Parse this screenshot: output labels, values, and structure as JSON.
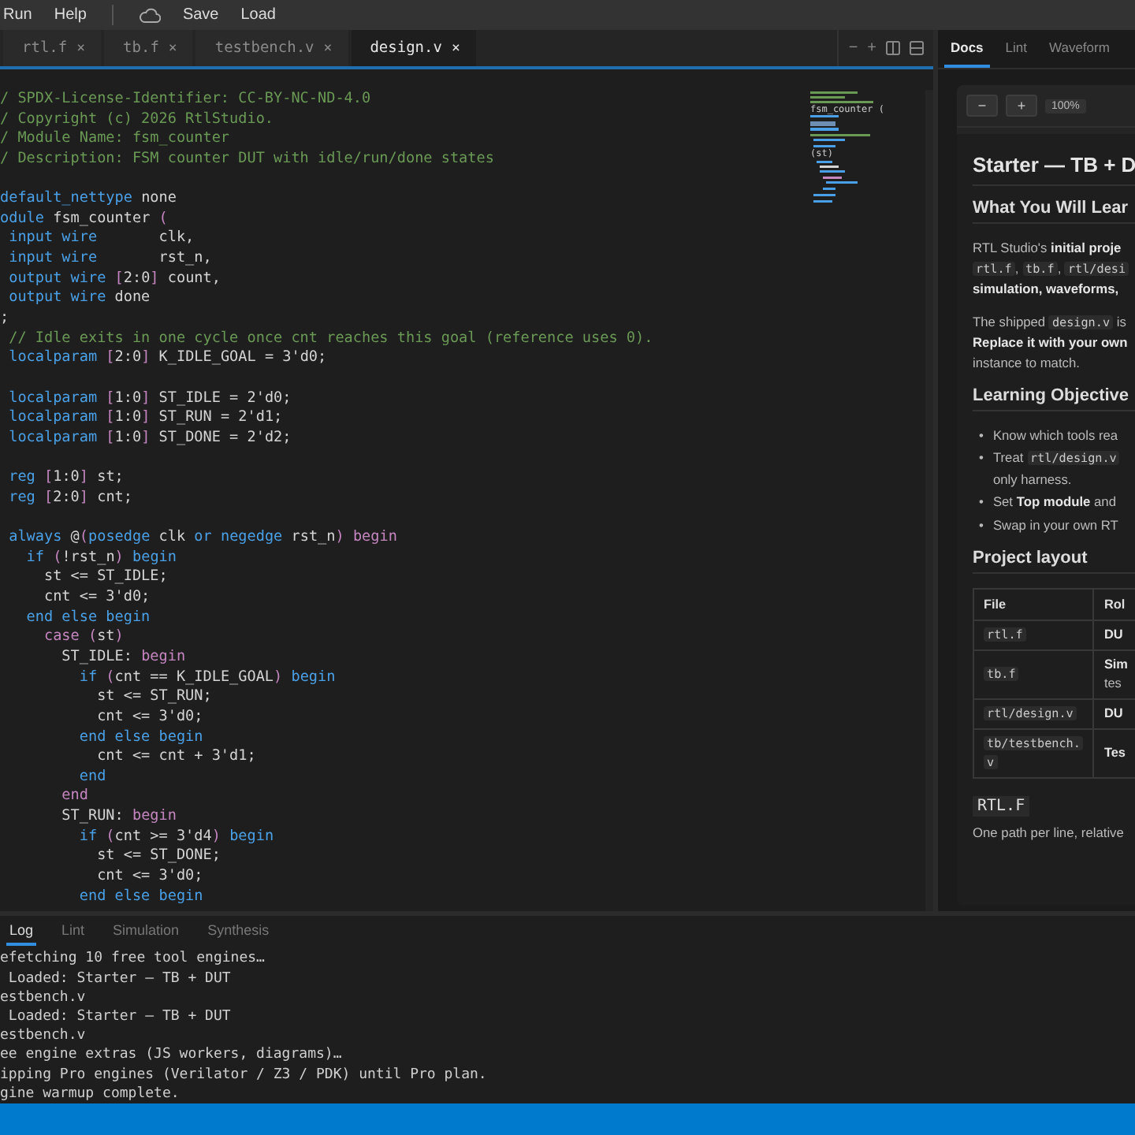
{
  "menu": {
    "items": [
      "Run",
      "Help"
    ],
    "actions": [
      "Save",
      "Load"
    ]
  },
  "editor_tabs": [
    {
      "label": "rtl.f",
      "close": "×",
      "selected": false
    },
    {
      "label": "tb.f",
      "close": "×",
      "selected": false
    },
    {
      "label": "testbench.v",
      "close": "×",
      "selected": false
    },
    {
      "label": "design.v",
      "close": "×",
      "selected": true
    }
  ],
  "editor_actions": [
    "−",
    "+"
  ],
  "code_lines": [
    {
      "kind": "code",
      "segs": [
        {
          "kind": "cm",
          "text": "/ SPDX-License-Identifier: CC-BY-NC-ND-4.0"
        }
      ]
    },
    {
      "kind": "code",
      "segs": [
        {
          "kind": "cm",
          "text": "/ Copyright (c) 2026 RtlStudio."
        }
      ]
    },
    {
      "kind": "code",
      "segs": [
        {
          "kind": "cm",
          "text": "/ Module Name: fsm_counter"
        }
      ]
    },
    {
      "kind": "code",
      "segs": [
        {
          "kind": "cm",
          "text": "/ Description: FSM counter DUT with idle/run/done states"
        }
      ]
    },
    {
      "kind": "blank"
    },
    {
      "kind": "code",
      "segs": [
        {
          "kind": "kw",
          "text": "default_nettype"
        },
        {
          "kind": "id",
          "text": " none"
        }
      ]
    },
    {
      "kind": "code",
      "segs": [
        {
          "kind": "kw",
          "text": "odule"
        },
        {
          "kind": "id",
          "text": " fsm_counter"
        },
        {
          "kind": "br",
          "text": " ("
        }
      ]
    },
    {
      "kind": "code",
      "segs": [
        {
          "kind": "kw",
          "text": " input wire"
        },
        {
          "kind": "id",
          "text": "       clk,"
        }
      ]
    },
    {
      "kind": "code",
      "segs": [
        {
          "kind": "kw",
          "text": " input wire"
        },
        {
          "kind": "id",
          "text": "       rst_n,"
        }
      ]
    },
    {
      "kind": "code",
      "segs": [
        {
          "kind": "kw",
          "text": " output wire"
        },
        {
          "kind": "br",
          "text": " ["
        },
        {
          "kind": "id",
          "text": "2:0"
        },
        {
          "kind": "br",
          "text": "]"
        },
        {
          "kind": "id",
          "text": " count,"
        }
      ]
    },
    {
      "kind": "code",
      "segs": [
        {
          "kind": "kw",
          "text": " output wire"
        },
        {
          "kind": "id",
          "text": " done"
        }
      ]
    },
    {
      "kind": "code",
      "segs": [
        {
          "kind": "id",
          "text": ";"
        }
      ]
    },
    {
      "kind": "code",
      "segs": [
        {
          "kind": "cm",
          "text": " // Idle exits in one cycle once cnt reaches this goal (reference uses 0)."
        }
      ]
    },
    {
      "kind": "code",
      "segs": [
        {
          "kind": "kw",
          "text": " localparam"
        },
        {
          "kind": "br",
          "text": " ["
        },
        {
          "kind": "id",
          "text": "2:0"
        },
        {
          "kind": "br",
          "text": "]"
        },
        {
          "kind": "id",
          "text": " K_IDLE_GOAL = 3'd0;"
        }
      ]
    },
    {
      "kind": "blank"
    },
    {
      "kind": "code",
      "segs": [
        {
          "kind": "kw",
          "text": " localparam"
        },
        {
          "kind": "br",
          "text": " ["
        },
        {
          "kind": "id",
          "text": "1:0"
        },
        {
          "kind": "br",
          "text": "]"
        },
        {
          "kind": "id",
          "text": " ST_IDLE = 2'd0;"
        }
      ]
    },
    {
      "kind": "code",
      "segs": [
        {
          "kind": "kw",
          "text": " localparam"
        },
        {
          "kind": "br",
          "text": " ["
        },
        {
          "kind": "id",
          "text": "1:0"
        },
        {
          "kind": "br",
          "text": "]"
        },
        {
          "kind": "id",
          "text": " ST_RUN = 2'd1;"
        }
      ]
    },
    {
      "kind": "code",
      "segs": [
        {
          "kind": "kw",
          "text": " localparam"
        },
        {
          "kind": "br",
          "text": " ["
        },
        {
          "kind": "id",
          "text": "1:0"
        },
        {
          "kind": "br",
          "text": "]"
        },
        {
          "kind": "id",
          "text": " ST_DONE = 2'd2;"
        }
      ]
    },
    {
      "kind": "blank"
    },
    {
      "kind": "code",
      "segs": [
        {
          "kind": "kw",
          "text": " reg"
        },
        {
          "kind": "br",
          "text": " ["
        },
        {
          "kind": "id",
          "text": "1:0"
        },
        {
          "kind": "br",
          "text": "]"
        },
        {
          "kind": "id",
          "text": " st;"
        }
      ]
    },
    {
      "kind": "code",
      "segs": [
        {
          "kind": "kw",
          "text": " reg"
        },
        {
          "kind": "br",
          "text": " ["
        },
        {
          "kind": "id",
          "text": "2:0"
        },
        {
          "kind": "br",
          "text": "]"
        },
        {
          "kind": "id",
          "text": " cnt;"
        }
      ]
    },
    {
      "kind": "blank"
    },
    {
      "kind": "code",
      "segs": [
        {
          "kind": "kw",
          "text": " always"
        },
        {
          "kind": "id",
          "text": " @"
        },
        {
          "kind": "br",
          "text": "("
        },
        {
          "kind": "kw",
          "text": "posedge"
        },
        {
          "kind": "id",
          "text": " clk"
        },
        {
          "kind": "kw",
          "text": " or negedge"
        },
        {
          "kind": "id",
          "text": " rst_n"
        },
        {
          "kind": "br",
          "text": ") begin"
        }
      ]
    },
    {
      "kind": "code",
      "segs": [
        {
          "kind": "kw",
          "text": "   if"
        },
        {
          "kind": "br",
          "text": " ("
        },
        {
          "kind": "id",
          "text": "!rst_n"
        },
        {
          "kind": "br",
          "text": ")"
        },
        {
          "kind": "kw",
          "text": " begin"
        }
      ]
    },
    {
      "kind": "code",
      "segs": [
        {
          "kind": "id",
          "text": "     st <= ST_IDLE;"
        }
      ]
    },
    {
      "kind": "code",
      "segs": [
        {
          "kind": "id",
          "text": "     cnt <= 3'd0;"
        }
      ]
    },
    {
      "kind": "code",
      "segs": [
        {
          "kind": "kw",
          "text": "   end else begin"
        }
      ]
    },
    {
      "kind": "code",
      "segs": [
        {
          "kind": "br",
          "text": "     case ("
        },
        {
          "kind": "id",
          "text": "st"
        },
        {
          "kind": "br",
          "text": ")"
        }
      ]
    },
    {
      "kind": "code",
      "segs": [
        {
          "kind": "id",
          "text": "       ST_IDLE:"
        },
        {
          "kind": "br",
          "text": " begin"
        }
      ]
    },
    {
      "kind": "code",
      "segs": [
        {
          "kind": "kw",
          "text": "         if"
        },
        {
          "kind": "br",
          "text": " ("
        },
        {
          "kind": "id",
          "text": "cnt == K_IDLE_GOAL"
        },
        {
          "kind": "br",
          "text": ")"
        },
        {
          "kind": "kw",
          "text": " begin"
        }
      ]
    },
    {
      "kind": "code",
      "segs": [
        {
          "kind": "id",
          "text": "           st <= ST_RUN;"
        }
      ]
    },
    {
      "kind": "code",
      "segs": [
        {
          "kind": "id",
          "text": "           cnt <= 3'd0;"
        }
      ]
    },
    {
      "kind": "code",
      "segs": [
        {
          "kind": "kw",
          "text": "         end else begin"
        }
      ]
    },
    {
      "kind": "code",
      "segs": [
        {
          "kind": "id",
          "text": "           cnt <= cnt + 3'd1;"
        }
      ]
    },
    {
      "kind": "code",
      "segs": [
        {
          "kind": "kw",
          "text": "         end"
        }
      ]
    },
    {
      "kind": "code",
      "segs": [
        {
          "kind": "br",
          "text": "       end"
        }
      ]
    },
    {
      "kind": "code",
      "segs": [
        {
          "kind": "id",
          "text": "       ST_RUN:"
        },
        {
          "kind": "br",
          "text": " begin"
        }
      ]
    },
    {
      "kind": "code",
      "segs": [
        {
          "kind": "kw",
          "text": "         if"
        },
        {
          "kind": "br",
          "text": " ("
        },
        {
          "kind": "id",
          "text": "cnt >= 3'd4"
        },
        {
          "kind": "br",
          "text": ")"
        },
        {
          "kind": "kw",
          "text": " begin"
        }
      ]
    },
    {
      "kind": "code",
      "segs": [
        {
          "kind": "id",
          "text": "           st <= ST_DONE;"
        }
      ]
    },
    {
      "kind": "code",
      "segs": [
        {
          "kind": "id",
          "text": "           cnt <= 3'd0;"
        }
      ]
    },
    {
      "kind": "code",
      "segs": [
        {
          "kind": "kw",
          "text": "         end else begin"
        }
      ]
    }
  ],
  "minimap": {
    "labels": [
      "fsm_counter (",
      "(st)"
    ]
  },
  "side_tabs": [
    {
      "label": "Docs",
      "selected": true
    },
    {
      "label": "Lint",
      "selected": false
    },
    {
      "label": "Waveform",
      "selected": false
    }
  ],
  "docs": {
    "zoom_buttons": [
      "−",
      "+"
    ],
    "zoom": "100%",
    "blocks": [
      {
        "kind": "h1",
        "text": "Starter — TB + D"
      },
      {
        "kind": "h2",
        "text": "What You Will Lear"
      },
      {
        "kind": "p",
        "lines": [
          [
            {
              "kind": "t",
              "text": "RTL Studio's "
            },
            {
              "kind": "b",
              "text": "initial proje"
            }
          ],
          [
            {
              "kind": "c",
              "text": "rtl.f"
            },
            {
              "kind": "t",
              "text": ", "
            },
            {
              "kind": "c",
              "text": "tb.f"
            },
            {
              "kind": "t",
              "text": ", "
            },
            {
              "kind": "c",
              "text": "rtl/desi"
            }
          ],
          [
            {
              "kind": "b",
              "text": "simulation, waveforms,"
            }
          ]
        ]
      },
      {
        "kind": "p",
        "lines": [
          [
            {
              "kind": "t",
              "text": "The shipped "
            },
            {
              "kind": "c",
              "text": "design.v"
            },
            {
              "kind": "t",
              "text": " is"
            }
          ],
          [
            {
              "kind": "b",
              "text": "Replace it with your own"
            }
          ],
          [
            {
              "kind": "t",
              "text": "instance to match."
            }
          ]
        ]
      },
      {
        "kind": "h2",
        "text": "Learning Objective"
      },
      {
        "kind": "ul",
        "items": [
          {
            "marker": "•",
            "lines": [
              [
                {
                  "kind": "t",
                  "text": "Know which tools rea"
                }
              ]
            ]
          },
          {
            "marker": "•",
            "lines": [
              [
                {
                  "kind": "t",
                  "text": "Treat "
                },
                {
                  "kind": "c",
                  "text": "rtl/design.v"
                }
              ],
              [
                {
                  "kind": "t",
                  "text": "only harness."
                }
              ]
            ]
          },
          {
            "marker": "•",
            "lines": [
              [
                {
                  "kind": "t",
                  "text": "Set "
                },
                {
                  "kind": "b",
                  "text": "Top module"
                },
                {
                  "kind": "t",
                  "text": " and"
                }
              ]
            ]
          },
          {
            "marker": "•",
            "lines": [
              [
                {
                  "kind": "t",
                  "text": "Swap in your own RT"
                }
              ]
            ]
          }
        ]
      },
      {
        "kind": "h2",
        "text": "Project layout"
      },
      {
        "kind": "table",
        "columns": [
          "File",
          "Rol"
        ],
        "rows": [
          [
            [
              [
                {
                  "kind": "c",
                  "text": "rtl.f"
                }
              ]
            ],
            [
              [
                {
                  "kind": "b",
                  "text": "DU"
                }
              ]
            ]
          ],
          [
            [
              [
                {
                  "kind": "c",
                  "text": "tb.f"
                }
              ]
            ],
            [
              [
                {
                  "kind": "b",
                  "text": "Sim"
                }
              ],
              [
                {
                  "kind": "t",
                  "text": "tes"
                }
              ]
            ]
          ],
          [
            [
              [
                {
                  "kind": "c",
                  "text": "rtl/design.v"
                }
              ]
            ],
            [
              [
                {
                  "kind": "b",
                  "text": "DU"
                }
              ]
            ]
          ],
          [
            [
              [
                {
                  "kind": "c",
                  "text": "tb/testbench."
                }
              ],
              [
                {
                  "kind": "c",
                  "text": "v"
                }
              ]
            ],
            [
              [
                {
                  "kind": "b",
                  "text": "Tes"
                }
              ]
            ]
          ]
        ]
      },
      {
        "kind": "h3code",
        "text": "RTL.F"
      },
      {
        "kind": "p",
        "lines": [
          [
            {
              "kind": "t",
              "text": "One path per line, relative"
            }
          ]
        ]
      }
    ]
  },
  "bottom_tabs": [
    {
      "label": "Log",
      "selected": true
    },
    {
      "label": "Lint",
      "selected": false
    },
    {
      "label": "Simulation",
      "selected": false
    },
    {
      "label": "Synthesis",
      "selected": false
    }
  ],
  "log_lines": [
    "efetching 10 free tool engines…",
    " Loaded: Starter — TB + DUT",
    "estbench.v",
    " Loaded: Starter — TB + DUT",
    "estbench.v",
    "ee engine extras (JS workers, diagrams)…",
    "ipping Pro engines (Verilator / Z3 / PDK) until Pro plan.",
    "gine warmup complete."
  ]
}
